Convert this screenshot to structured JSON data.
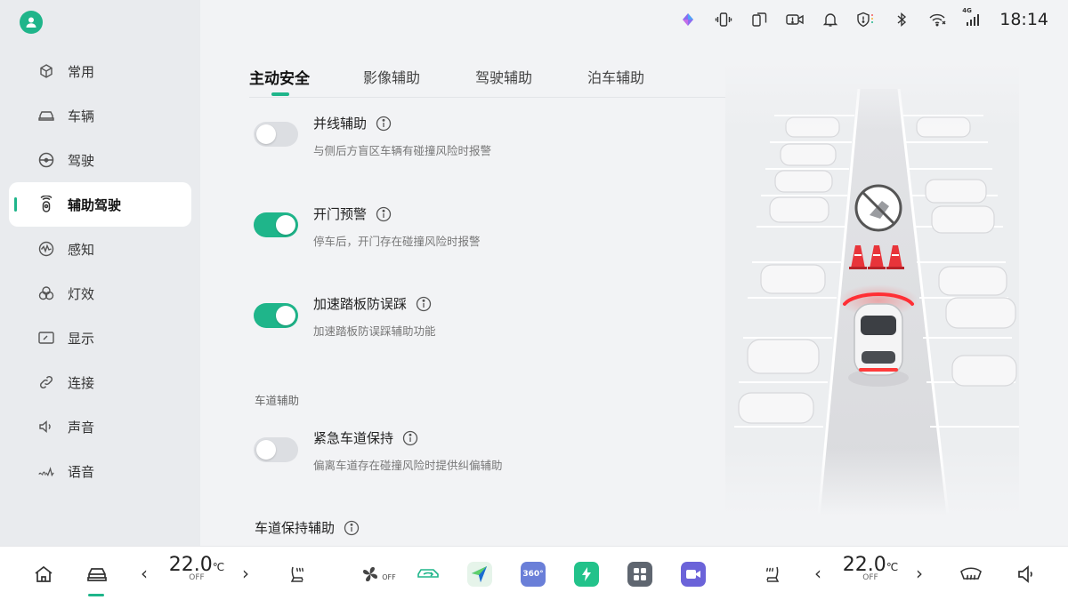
{
  "sidebar": {
    "avatar_icon": "user-icon",
    "items": [
      {
        "label": "常用",
        "icon": "cube-icon"
      },
      {
        "label": "车辆",
        "icon": "car-icon"
      },
      {
        "label": "驾驶",
        "icon": "steering-wheel-icon"
      },
      {
        "label": "辅助驾驶",
        "icon": "assist-driving-icon",
        "active": true
      },
      {
        "label": "感知",
        "icon": "perception-icon"
      },
      {
        "label": "灯效",
        "icon": "light-effect-icon"
      },
      {
        "label": "显示",
        "icon": "display-icon"
      },
      {
        "label": "连接",
        "icon": "link-icon"
      },
      {
        "label": "声音",
        "icon": "speaker-icon"
      },
      {
        "label": "语音",
        "icon": "voice-icon"
      }
    ]
  },
  "status_bar": {
    "network": "4G",
    "time": "18:14"
  },
  "tabs": [
    {
      "label": "主动安全",
      "active": true
    },
    {
      "label": "影像辅助"
    },
    {
      "label": "驾驶辅助"
    },
    {
      "label": "泊车辅助"
    }
  ],
  "settings": [
    {
      "title": "并线辅助",
      "desc": "与侧后方盲区车辆有碰撞风险时报警",
      "enabled": false
    },
    {
      "title": "开门预警",
      "desc": "停车后，开门存在碰撞风险时报警",
      "enabled": true
    },
    {
      "title": "加速踏板防误踩",
      "desc": "加速踏板防误踩辅助功能",
      "enabled": true
    }
  ],
  "lane_section": {
    "label": "车道辅助",
    "items": [
      {
        "title": "紧急车道保持",
        "desc": "偏离车道存在碰撞风险时提供纠偏辅助",
        "enabled": false
      }
    ],
    "lane_keep_title": "车道保持辅助"
  },
  "dock": {
    "left_temp": {
      "value": "22.0",
      "unit": "℃",
      "state": "OFF"
    },
    "right_temp": {
      "value": "22.0",
      "unit": "℃",
      "state": "OFF"
    },
    "fan_state": "OFF",
    "app_360_label": "360°",
    "colors": {
      "accent": "#1fb58a"
    }
  }
}
